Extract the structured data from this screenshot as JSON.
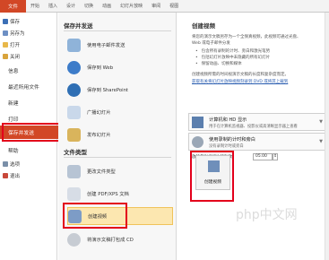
{
  "ribbon": {
    "file_tab": "文件",
    "tabs": [
      "开始",
      "插入",
      "设计",
      "切换",
      "动画",
      "幻灯片放映",
      "审阅",
      "视图"
    ]
  },
  "nav": {
    "items": [
      {
        "label": "保存"
      },
      {
        "label": "另存为"
      },
      {
        "label": "打开"
      },
      {
        "label": "关闭"
      },
      {
        "label": "信息"
      },
      {
        "label": "最近所用文件"
      },
      {
        "label": "新建"
      },
      {
        "label": "打印"
      },
      {
        "label": "保存并发送"
      },
      {
        "label": "帮助"
      },
      {
        "label": "选项"
      },
      {
        "label": "退出"
      }
    ]
  },
  "middle": {
    "section1_title": "保存并发送",
    "items": [
      {
        "label": "使用电子邮件发送"
      },
      {
        "label": "保存到 Web"
      },
      {
        "label": "保存到 SharePoint"
      },
      {
        "label": "广播幻灯片"
      },
      {
        "label": "发布幻灯片"
      }
    ],
    "section2_title": "文件类型",
    "file_types": [
      {
        "label": "更改文件类型"
      },
      {
        "label": "创建 PDF/XPS 文档"
      },
      {
        "label": "创建视频"
      },
      {
        "label": "将演示文稿打包成 CD"
      }
    ]
  },
  "right": {
    "title": "创建视频",
    "desc_lines": [
      "将您的演示文稿另存为一个全保真视频，此视频可通过光盘、",
      "Web 或电子邮件分发"
    ],
    "bullets": [
      "包含所有录制的计时、旁白和激光笔势",
      "包括幻灯片放映中未隐藏的所有幻灯片",
      "保留动画、切换和媒体"
    ],
    "note": "创建视频所需的时间视演示文稿的长度和复杂度而定。",
    "link": "获取有关将幻灯片放映视频刻录到 DVD 或将其上载到",
    "option1": {
      "title": "计算机和 HD 显示",
      "sub": "用于在计算机监视器、投影仪或高清晰显示器上查看"
    },
    "option2": {
      "title": "使用录制的计时和旁白",
      "sub": "没有录制计时或旁白"
    },
    "seconds_label": "放映每张幻灯片的秒数：",
    "seconds_value": "05.00",
    "create_button": "创建视频"
  },
  "colors": {
    "accent": "#d24726",
    "highlight": "#e3001b",
    "selected_bg": "#fce7b0"
  }
}
